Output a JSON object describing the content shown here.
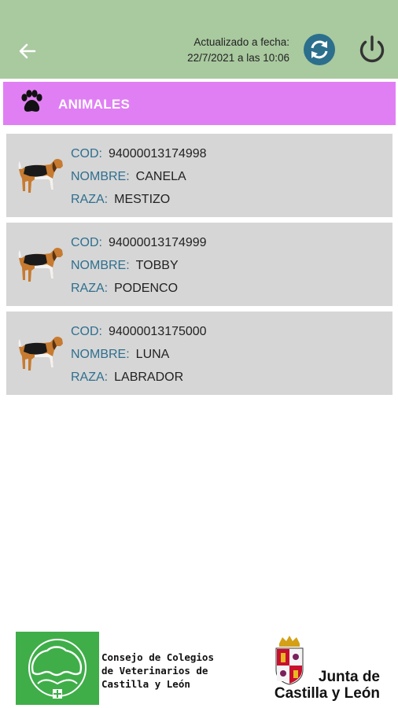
{
  "header": {
    "updated_line1": "Actualizado a fecha:",
    "updated_line2": "22/7/2021 a las 10:06"
  },
  "section": {
    "title": "ANIMALES"
  },
  "labels": {
    "cod": "COD:",
    "nombre": "NOMBRE:",
    "raza": "RAZA:"
  },
  "animals": [
    {
      "cod": "94000013174998",
      "nombre": "CANELA",
      "raza": "MESTIZO"
    },
    {
      "cod": "94000013174999",
      "nombre": "TOBBY",
      "raza": "PODENCO"
    },
    {
      "cod": "94000013175000",
      "nombre": "LUNA",
      "raza": "LABRADOR"
    }
  ],
  "footer": {
    "consejo_text": "Consejo de Colegios\nde Veterinarios de\nCastilla y León",
    "junta_line1": "Junta de",
    "junta_line2": "Castilla y León"
  },
  "colors": {
    "topbar": "#a9c99f",
    "section": "#e07ff4",
    "card": "#d6d6d6",
    "accent": "#2f6f8f"
  },
  "icons": [
    "back-arrow-icon",
    "sync-icon",
    "power-icon",
    "paw-icon",
    "dog-icon",
    "consejo-logo",
    "junta-shield-icon"
  ]
}
